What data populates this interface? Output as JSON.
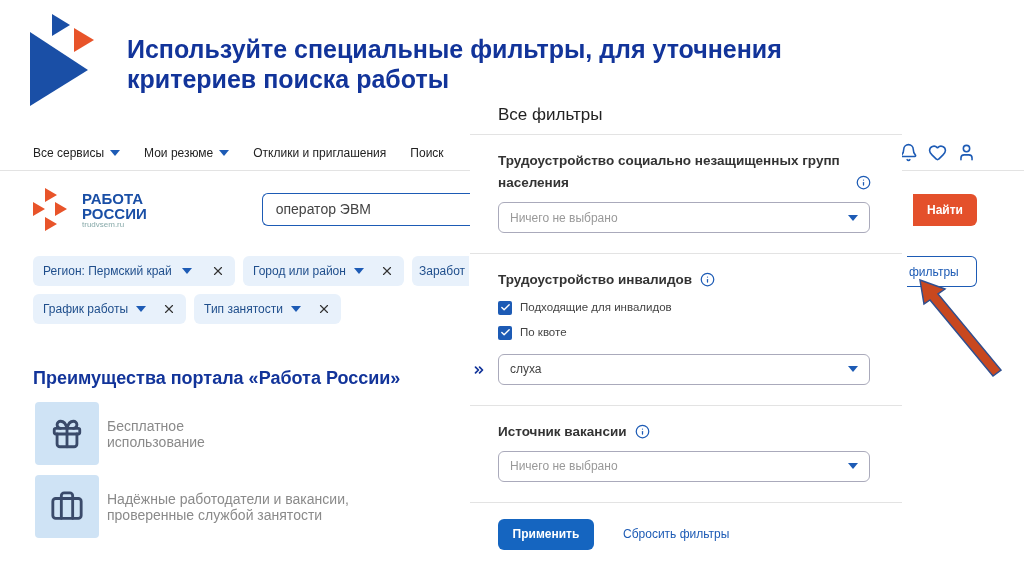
{
  "slide": {
    "title": "Используйте специальные фильтры, для уточнения критериев поиска работы"
  },
  "site": {
    "nav": [
      {
        "label": "Все сервисы",
        "dropdown": true
      },
      {
        "label": "Мои резюме",
        "dropdown": true
      },
      {
        "label": "Отклики и приглашения",
        "dropdown": false
      },
      {
        "label": "Поиск",
        "dropdown": false
      }
    ],
    "logo": {
      "line1": "РАБОТА",
      "line2": "РОССИИ",
      "url": "trudvsem.ru"
    },
    "search": {
      "value": "оператор ЭВМ"
    },
    "search_button": "Найти",
    "chip_rows": [
      [
        {
          "label": "Регион: Пермский край",
          "dropdown": true,
          "removable": true
        },
        {
          "label": "Город или район",
          "dropdown": true,
          "removable": true
        },
        {
          "label": "Заработ"
        }
      ],
      [
        {
          "label": "График работы",
          "dropdown": true,
          "removable": true
        },
        {
          "label": "Тип занятости",
          "dropdown": true,
          "removable": true
        }
      ]
    ],
    "filters_button": "фильтры",
    "advantages": {
      "title": "Преимущества портала «Работа России»",
      "items": [
        {
          "kind": "gift",
          "text": "Бесплатное использование"
        },
        {
          "kind": "briefcase",
          "text": "Надёжные работодатели и вакансии, проверенные службой занятости"
        }
      ]
    }
  },
  "filter_panel": {
    "title": "Все фильтры",
    "sections": [
      {
        "label": "Трудоустройство социально незащищенных групп населения",
        "info": true,
        "select": {
          "placeholder": "Ничего не выбрано"
        }
      },
      {
        "label": "Трудоустройство инвалидов",
        "info": true,
        "checkboxes": [
          {
            "label": "Подходящие для инвалидов",
            "checked": true
          },
          {
            "label": "По квоте",
            "checked": true
          }
        ],
        "select": {
          "value": "слуха",
          "marker": true
        }
      },
      {
        "label": "Источник вакансии",
        "info": true,
        "select": {
          "placeholder": "Ничего не выбрано"
        }
      }
    ],
    "apply": "Применить",
    "reset": "Сбросить фильтры"
  }
}
